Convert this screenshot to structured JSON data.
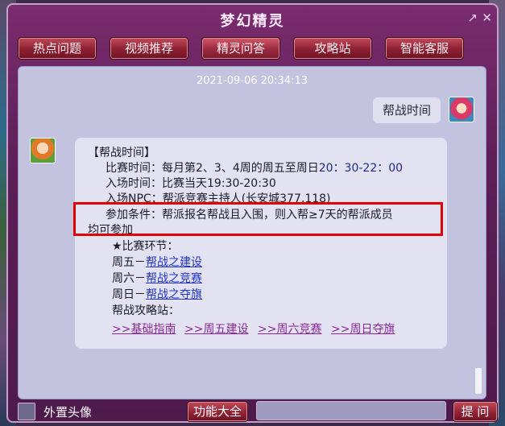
{
  "window": {
    "title": "梦幻精灵",
    "expand_icon": "↗",
    "close_icon": "✕"
  },
  "tabs": [
    {
      "label": "热点问题"
    },
    {
      "label": "视频推荐"
    },
    {
      "label": "精灵问答"
    },
    {
      "label": "攻略站"
    },
    {
      "label": "智能客服"
    }
  ],
  "chat": {
    "timestamp": "2021-09-06 20:34:13",
    "user_message": "帮战时间",
    "bot": {
      "heading": "【帮战时间】",
      "time_label": "比赛时间：每月第2、3、4周的周五至周日",
      "time_value": "20：30-22：00",
      "entry_time": "入场时间：比赛当天19:30-20:30",
      "entry_npc": "入场NPC：帮派竞赛主持人(长安城377,118)",
      "condition_line1": "参加条件：帮派报名帮战且入围，则入帮≥7天的帮派成员",
      "condition_line2": "均可参加",
      "stages_heading": "★比赛环节：",
      "stages": [
        {
          "day": "周五－",
          "link": "帮战之建设"
        },
        {
          "day": "周六－",
          "link": "帮战之竞赛"
        },
        {
          "day": "周日－",
          "link": "帮战之夺旗"
        }
      ],
      "guide_heading": "帮战攻略站：",
      "guide_links": [
        ">>基础指南",
        ">>周五建设",
        ">>周六竞赛",
        ">>周日夺旗"
      ]
    }
  },
  "bottom": {
    "checkbox_label": "外置头像",
    "function_button": "功能大全",
    "input_value": "",
    "ask_button": "提 问"
  },
  "colors": {
    "window_bg": "#5c1f57",
    "chat_bg": "#c3c2df",
    "tab_red": "#8c2032",
    "link_blue": "#2233cc",
    "highlight": "#e00000"
  }
}
